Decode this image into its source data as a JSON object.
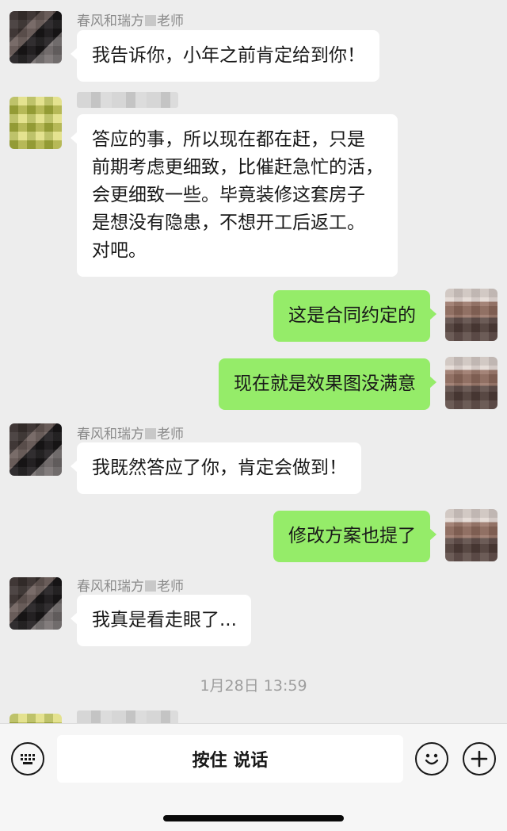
{
  "messages": [
    {
      "side": "in",
      "sender": [
        "春风和瑞方",
        "老师"
      ],
      "text": [
        "我告诉你，小年之前肯定给到你！"
      ],
      "avatar": "dark"
    },
    {
      "side": "in",
      "sender": null,
      "text": [
        "答应的事，所以现在都在赶，只是",
        "前期考虑更细致，比催赶急忙的活，",
        "会更细致一些。毕竟装修这套房子",
        "是想没有隐患，不想开工后返工。",
        "对吧。"
      ],
      "avatar": "yellow"
    },
    {
      "side": "out",
      "text": [
        "这是合同约定的"
      ],
      "avatar": "person"
    },
    {
      "side": "out",
      "text": [
        "现在就是效果图没满意"
      ],
      "avatar": "person"
    },
    {
      "side": "in",
      "sender": [
        "春风和瑞方",
        "老师"
      ],
      "text": [
        "我既然答应了你，肯定会做到！"
      ],
      "avatar": "dark"
    },
    {
      "side": "out",
      "text": [
        "修改方案也提了"
      ],
      "avatar": "person"
    },
    {
      "side": "in",
      "sender": [
        "春风和瑞方",
        "老师"
      ],
      "text": [
        "我真是看走眼了..."
      ],
      "avatar": "dark"
    }
  ],
  "timestamp": "1月28日 13:59",
  "input_bar": {
    "voice_icon": "keyboard-icon",
    "talk_label": "按住 说话",
    "emoji_icon": "emoji-icon",
    "more_icon": "plus-icon"
  },
  "colors": {
    "background": "#ededed",
    "bubble_in": "#ffffff",
    "bubble_out": "#95ec69"
  }
}
